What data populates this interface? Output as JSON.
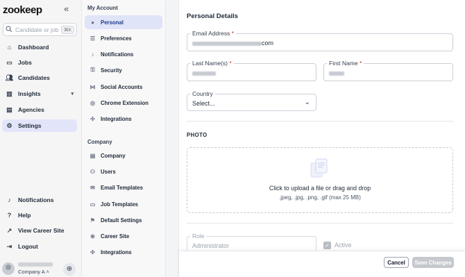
{
  "brand": {
    "logo": "zookeep"
  },
  "search": {
    "placeholder": "Candidate or job",
    "shortcut": "⌘K"
  },
  "sidebar": {
    "items": [
      {
        "label": "Dashboard",
        "icon": "home-icon"
      },
      {
        "label": "Jobs",
        "icon": "briefcase-icon"
      },
      {
        "label": "Candidates",
        "icon": "users-icon"
      },
      {
        "label": "Insights",
        "icon": "chart-icon"
      },
      {
        "label": "Agencies",
        "icon": "building-icon"
      },
      {
        "label": "Settings",
        "icon": "gear-icon"
      }
    ],
    "bottom_items": [
      {
        "label": "Notifications",
        "icon": "bell-icon"
      },
      {
        "label": "Help",
        "icon": "help-icon"
      },
      {
        "label": "View Career Site",
        "icon": "external-link-icon"
      },
      {
        "label": "Logout",
        "icon": "logout-icon"
      }
    ],
    "company": "Company A"
  },
  "subnav": {
    "account_title": "My Account",
    "account_items": [
      "Personal",
      "Preferences",
      "Notifications",
      "Security",
      "Social Accounts",
      "Chrome Extension",
      "Integrations"
    ],
    "company_title": "Company",
    "company_items": [
      "Company",
      "Users",
      "Email Templates",
      "Job Templates",
      "Default Settings",
      "Career Site",
      "Integrations"
    ]
  },
  "form": {
    "title": "Personal Details",
    "email_label": "Email Address",
    "email_suffix": "com",
    "last_name_label": "Last Name(s)",
    "first_name_label": "First Name",
    "country_label": "Country",
    "country_placeholder": "Select...",
    "required_mark": "*"
  },
  "photo": {
    "title": "PHOTO",
    "upload_text": "Click to upload a file or drag and drop",
    "formats": ".jpeg, .jpg, .png, .gif (max 25 MB)"
  },
  "role": {
    "label": "Role",
    "value": "Administrator",
    "active_label": "Active",
    "active_checked": true
  },
  "footer": {
    "cancel": "Cancel",
    "save": "Save Changes"
  },
  "colors": {
    "active_nav": "#e2e5fa",
    "required": "#dc2626",
    "save_disabled": "#c5c8cd"
  }
}
